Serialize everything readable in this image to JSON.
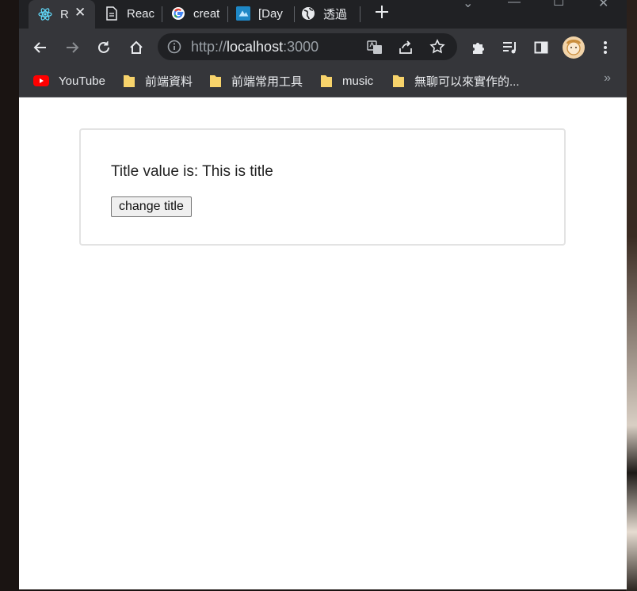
{
  "tabs": [
    {
      "title": "R",
      "icon": "react-icon",
      "active": true
    },
    {
      "title": "Reac",
      "icon": "document-icon"
    },
    {
      "title": "creat",
      "icon": "google-icon"
    },
    {
      "title": "[Day",
      "icon": "ithome-icon"
    },
    {
      "title": "透過",
      "icon": "globe-icon"
    }
  ],
  "toolbar": {
    "url_scheme": "http://",
    "url_host": "localhost",
    "url_port": ":3000"
  },
  "bookmarks": [
    {
      "label": "YouTube",
      "icon": "youtube-icon"
    },
    {
      "label": "前端資料",
      "icon": "folder-icon"
    },
    {
      "label": "前端常用工具",
      "icon": "folder-icon"
    },
    {
      "label": "music",
      "icon": "folder-icon"
    },
    {
      "label": "無聊可以來實作的...",
      "icon": "folder-icon"
    }
  ],
  "bookmarks_more": "»",
  "page": {
    "title_text": "Title value is: This is title",
    "button_label": "change title"
  },
  "colors": {
    "tab_strip": "#202124",
    "toolbar": "#35363a",
    "page_bg": "#ffffff",
    "card_border": "#e3e3e3"
  }
}
